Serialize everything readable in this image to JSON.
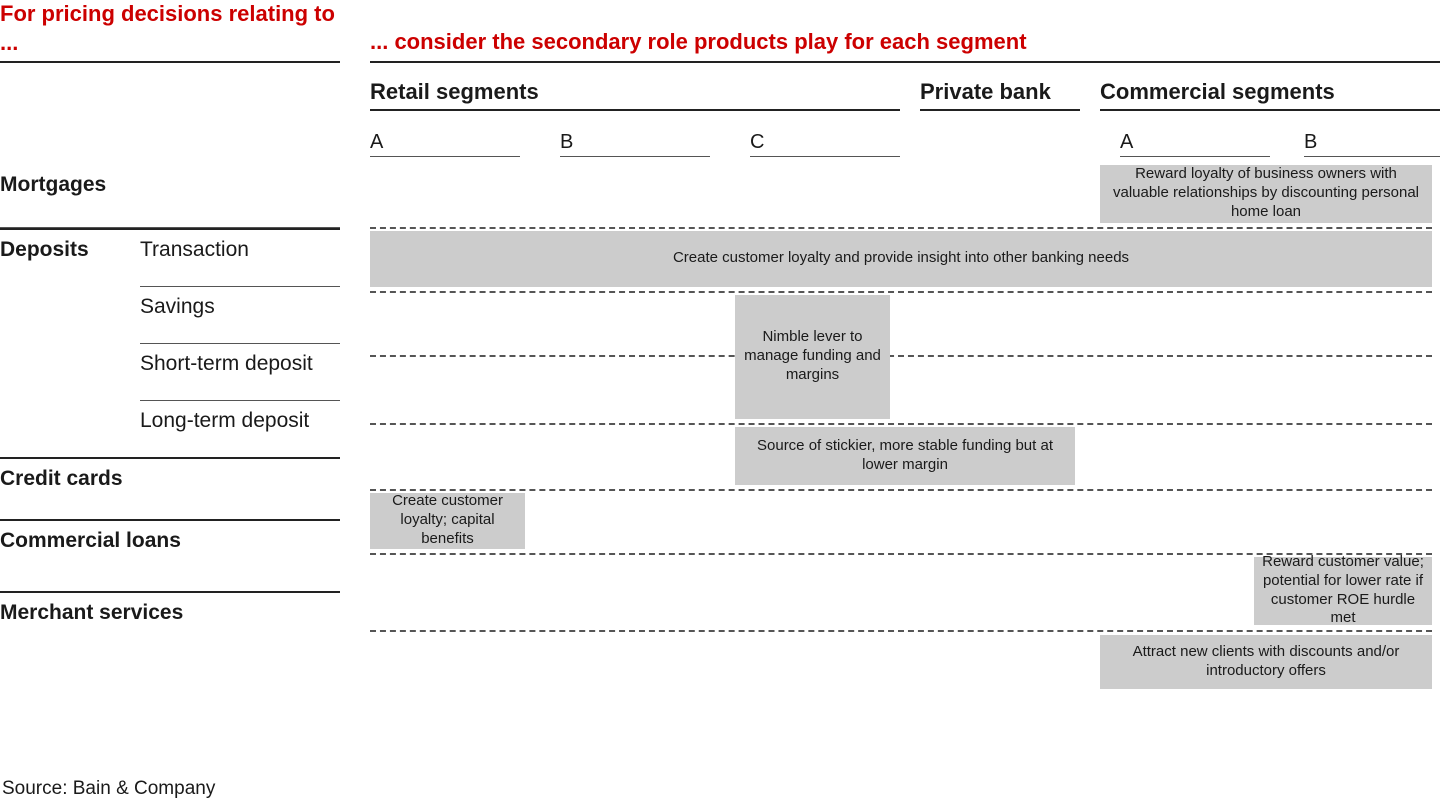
{
  "header": {
    "left_title": "For pricing decisions relating to ...",
    "right_title": "... consider the secondary role products play for each segment"
  },
  "segments": {
    "retail": {
      "title": "Retail segments",
      "subs": [
        "A",
        "B",
        "C"
      ]
    },
    "private": {
      "title": "Private bank"
    },
    "commercial": {
      "title": "Commercial segments",
      "subs": [
        "A",
        "B"
      ]
    }
  },
  "products": {
    "mortgages": "Mortgages",
    "deposits": {
      "label": "Deposits",
      "subs": {
        "transaction": "Transaction",
        "savings": "Savings",
        "short": "Short-term deposit",
        "long": "Long-term deposit"
      }
    },
    "credit": "Credit cards",
    "commercial_loans": "Commercial loans",
    "merchant": "Merchant services"
  },
  "callouts": {
    "mortgages_commercial": "Reward loyalty of business owners with valuable relationships by discounting personal home loan",
    "transaction_all": "Create customer loyalty and provide insight into other banking needs",
    "savings_nimble": "Nimble lever to manage funding and margins",
    "longterm_stable": "Source of stickier, more stable funding but at lower margin",
    "credit_retailA": "Create customer loyalty; capital benefits",
    "commloans_commB": "Reward customer value; potential for lower rate if customer ROE hurdle met",
    "merchant_commercial": "Attract new clients with discounts and/or introductory offers"
  },
  "source": "Source: Bain & Company"
}
